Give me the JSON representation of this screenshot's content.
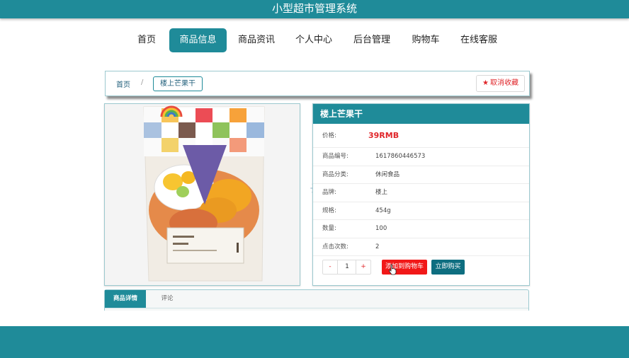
{
  "app": {
    "title": "小型超市管理系统"
  },
  "nav": {
    "items": [
      {
        "label": "首页",
        "active": false
      },
      {
        "label": "商品信息",
        "active": true
      },
      {
        "label": "商品资讯",
        "active": false
      },
      {
        "label": "个人中心",
        "active": false
      },
      {
        "label": "后台管理",
        "active": false
      },
      {
        "label": "购物车",
        "active": false
      },
      {
        "label": "在线客服",
        "active": false
      }
    ]
  },
  "breadcrumb": {
    "home": "首页",
    "separator": "/",
    "current": "楼上芒果干"
  },
  "favorite": {
    "label": "取消收藏",
    "icon": "star-icon"
  },
  "product": {
    "name": "楼上芒果干",
    "image_alt": "楼上芒果干",
    "package_brand_text": "楼上",
    "fields": [
      {
        "label": "价格:",
        "value": "39RMB"
      },
      {
        "label": "商品编号:",
        "value": "1617860446573"
      },
      {
        "label": "商品分类:",
        "value": "休闲食品"
      },
      {
        "label": "品牌:",
        "value": "楼上"
      },
      {
        "label": "规格:",
        "value": "454g"
      },
      {
        "label": "数量:",
        "value": "100"
      },
      {
        "label": "点击次数:",
        "value": "2"
      }
    ]
  },
  "actions": {
    "minus": "-",
    "quantity": "1",
    "plus": "+",
    "add_to_cart": "添加到购物车",
    "buy_now": "立即购买"
  },
  "tabs": [
    {
      "label": "商品详情",
      "active": true
    },
    {
      "label": "评论",
      "active": false
    }
  ],
  "colors": {
    "primary": "#1f8b99",
    "danger": "#f11818",
    "buy": "#0e6e80",
    "price": "#e0262a"
  }
}
